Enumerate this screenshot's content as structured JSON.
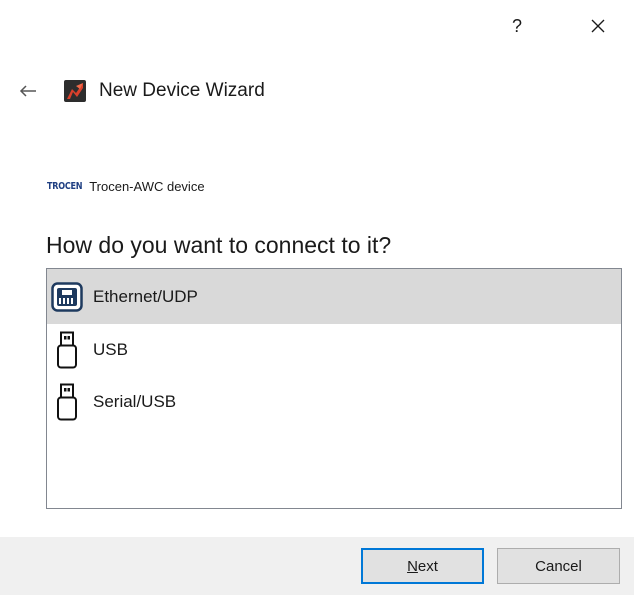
{
  "titlebar": {
    "help_label": "?",
    "close_label": "✕"
  },
  "header": {
    "back_icon": "back-arrow-icon",
    "app_icon": "app-logo-icon",
    "title": "New Device Wizard"
  },
  "device": {
    "brand_logo_text": "TROCEN",
    "name": "Trocen-AWC device"
  },
  "question": "How do you want to connect to it?",
  "connection_options": [
    {
      "label": "Ethernet/UDP",
      "icon": "ethernet-port-icon",
      "selected": true
    },
    {
      "label": "USB",
      "icon": "usb-plug-icon",
      "selected": false
    },
    {
      "label": "Serial/USB",
      "icon": "usb-plug-icon",
      "selected": false
    }
  ],
  "footer": {
    "next_label_accel": "N",
    "next_label_rest": "ext",
    "cancel_label": "Cancel"
  },
  "colors": {
    "selection_bg": "#d9d9d9",
    "footer_bg": "#f0f0f0",
    "default_button_border": "#0078d7",
    "brand_blue": "#1f3f82",
    "ethernet_icon_blue": "#1e3a5f"
  }
}
